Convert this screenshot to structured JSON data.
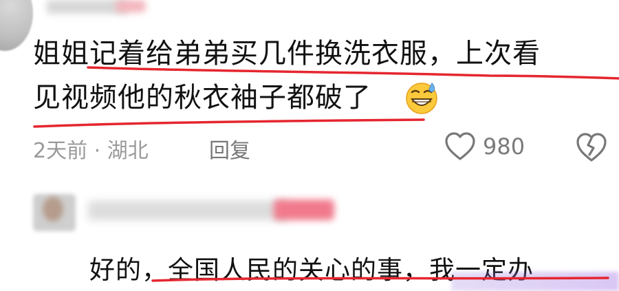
{
  "comments": [
    {
      "text_line1": "姐姐记着给弟弟买几件换洗衣服，上次看",
      "text_line2": "见视频他的秋衣袖子都破了",
      "emoji": "grinning-sweat-emoji",
      "meta": "2天前 · 湖北",
      "reply_label": "回复",
      "likes": "980"
    },
    {
      "text": "好的，全国人民的关心的事，我一定办"
    }
  ],
  "colors": {
    "underline": "#e5262f",
    "text": "#111111",
    "meta": "#9a9a9a"
  }
}
